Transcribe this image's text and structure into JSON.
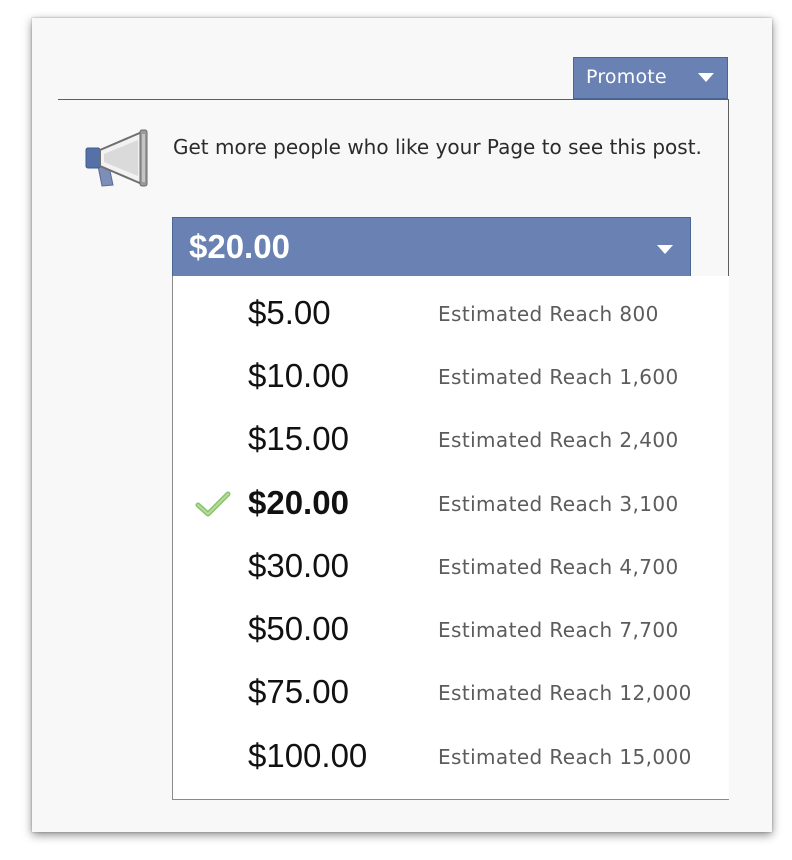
{
  "promote": {
    "label": "Promote",
    "icon": "chevron-down-icon"
  },
  "description": "Get more people who like your Page to see this post.",
  "megaphone_icon": "megaphone-icon",
  "budget_select": {
    "value": "$20.00",
    "icon": "chevron-down-icon"
  },
  "options": [
    {
      "amount": "$5.00",
      "reach": "Estimated Reach 800",
      "selected": false
    },
    {
      "amount": "$10.00",
      "reach": "Estimated Reach 1,600",
      "selected": false
    },
    {
      "amount": "$15.00",
      "reach": "Estimated Reach 2,400",
      "selected": false
    },
    {
      "amount": "$20.00",
      "reach": "Estimated Reach 3,100",
      "selected": true
    },
    {
      "amount": "$30.00",
      "reach": "Estimated Reach 4,700",
      "selected": false
    },
    {
      "amount": "$50.00",
      "reach": "Estimated Reach 7,700",
      "selected": false
    },
    {
      "amount": "$75.00",
      "reach": "Estimated Reach 12,000",
      "selected": false
    },
    {
      "amount": "$100.00",
      "reach": "Estimated Reach 15,000",
      "selected": false
    }
  ],
  "colors": {
    "accent": "#6a81b3",
    "check": "#8cc26e",
    "reach_text": "#5c5c5c"
  }
}
